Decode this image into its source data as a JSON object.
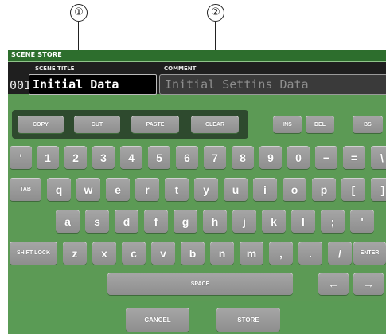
{
  "callouts": [
    "①",
    "②"
  ],
  "window": {
    "title": "SCENE STORE"
  },
  "scene": {
    "number": "001",
    "title_label": "SCENE TITLE",
    "title_value": "Initial Data",
    "comment_label": "COMMENT",
    "comment_value": "Initial Settins Data"
  },
  "edit_keys": [
    "COPY",
    "CUT",
    "PASTE",
    "CLEAR"
  ],
  "control_keys": [
    "INS",
    "DEL",
    "BS"
  ],
  "rows": {
    "row1": [
      "'",
      "1",
      "2",
      "3",
      "4",
      "5",
      "6",
      "7",
      "8",
      "9",
      "0",
      "−",
      "=",
      "\\"
    ],
    "row2": [
      "TAB",
      "q",
      "w",
      "e",
      "r",
      "t",
      "y",
      "u",
      "i",
      "o",
      "p",
      "[",
      "]"
    ],
    "row3": [
      "a",
      "s",
      "d",
      "f",
      "g",
      "h",
      "j",
      "k",
      "l",
      ";",
      "'"
    ],
    "row4": [
      "SHIFT LOCK",
      "z",
      "x",
      "c",
      "v",
      "b",
      "n",
      "m",
      ",",
      ".",
      "/",
      "ENTER"
    ]
  },
  "space_label": "SPACE",
  "arrows": {
    "left": "←",
    "right": "→"
  },
  "buttons": {
    "cancel": "CANCEL",
    "store": "STORE"
  }
}
